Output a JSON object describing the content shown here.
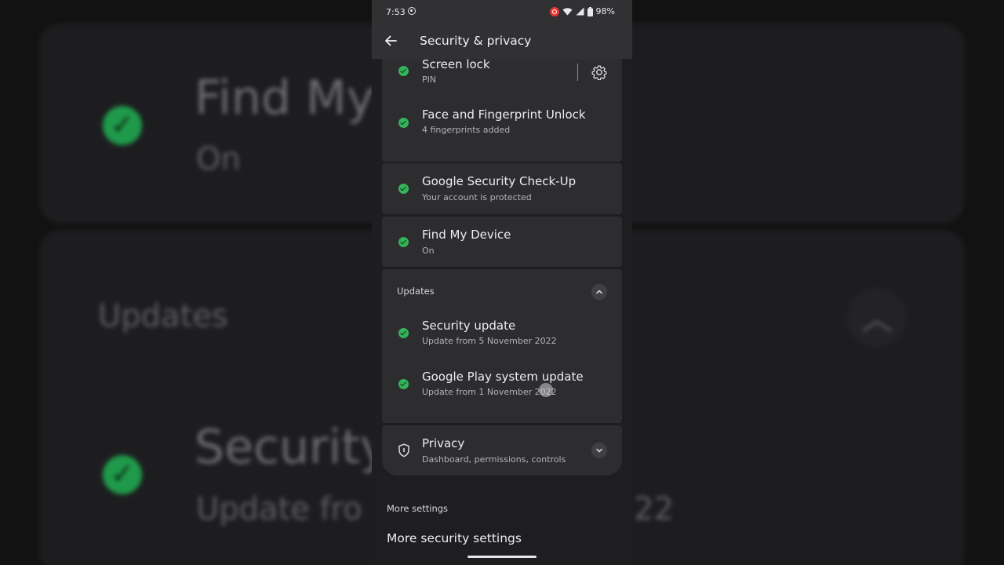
{
  "status_bar": {
    "time": "7:53",
    "battery": "98%"
  },
  "app_bar": {
    "title": "Security & privacy"
  },
  "security_items": [
    {
      "title": "Screen lock",
      "subtitle": "PIN"
    },
    {
      "title": "Face and Fingerprint Unlock",
      "subtitle": "4 fingerprints added"
    },
    {
      "title": "Google Security Check-Up",
      "subtitle": "Your account is protected"
    },
    {
      "title": "Find My Device",
      "subtitle": "On"
    }
  ],
  "updates": {
    "header": "Updates",
    "items": [
      {
        "title": "Security update",
        "subtitle": "Update from 5 November 2022"
      },
      {
        "title": "Google Play system update",
        "subtitle": "Update from 1 November 2022"
      }
    ]
  },
  "privacy": {
    "title": "Privacy",
    "subtitle": "Dashboard, permissions, controls"
  },
  "more_settings": {
    "header": "More settings",
    "item": "More security settings"
  },
  "background": {
    "find_title": "Find My",
    "find_sub": "On",
    "updates": "Updates",
    "security_title": "Security",
    "security_sub": "Update fro",
    "security_sub_tail": "22"
  },
  "colors": {
    "check_green": "#34b35a",
    "card_bg": "#2d2d30",
    "screen_bg": "#1e1e20"
  },
  "icons": [
    "back-arrow-icon",
    "gear-icon",
    "check-icon",
    "chevron-up-icon",
    "chevron-down-icon",
    "shield-icon",
    "wifi-icon",
    "signal-icon",
    "battery-icon"
  ]
}
